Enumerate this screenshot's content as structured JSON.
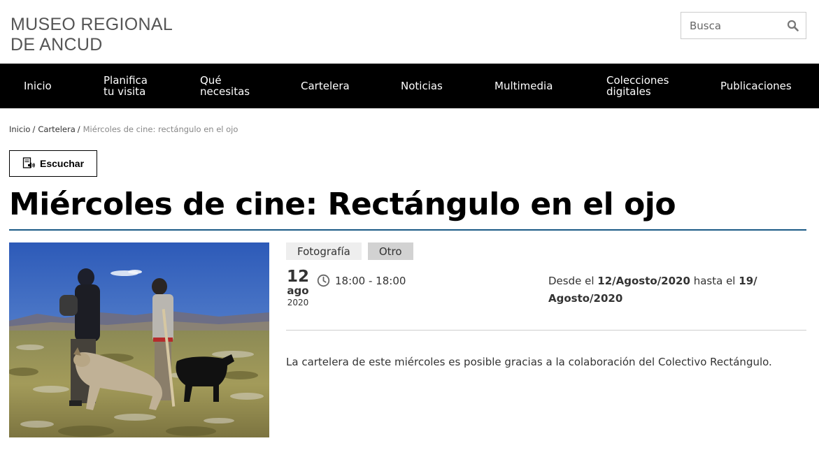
{
  "header": {
    "logo_line1": "MUSEO REGIONAL",
    "logo_line2": "DE ANCUD",
    "search_placeholder": "Busca",
    "search_icon": "search-icon"
  },
  "nav": {
    "items": [
      {
        "label": "Inicio"
      },
      {
        "label": "Planifica\ntu visita"
      },
      {
        "label": "Qué\nnecesitas"
      },
      {
        "label": "Cartelera"
      },
      {
        "label": "Noticias"
      },
      {
        "label": "Multimedia"
      },
      {
        "label": "Colecciones\ndigitales"
      },
      {
        "label": "Publicaciones"
      }
    ]
  },
  "breadcrumb": {
    "items": [
      "Inicio",
      "Cartelera"
    ],
    "separator": "/",
    "current": "Miércoles de cine: rectángulo en el ojo"
  },
  "listen": {
    "label": "Escuchar",
    "icon": "speaker-icon"
  },
  "event": {
    "title": "Miércoles de cine: Rectángulo en el ojo",
    "tags": [
      "Fotografía",
      "Otro"
    ],
    "date_day": "12",
    "date_month": "ago",
    "date_year": "2020",
    "time": "18:00 - 18:00",
    "range_prefix": "Desde el",
    "range_start": "12/Agosto/2020",
    "range_middle": "hasta el",
    "range_end": "19/ Agosto/2020",
    "description": "La cartelera de este miércoles es posible gracias a la colaboración del Colectivo Rectángulo."
  },
  "colors": {
    "nav_bg": "#000000",
    "title_rule": "#1c5b86",
    "tag1_bg": "#eeeeee",
    "tag2_bg": "#d2d2d2"
  }
}
